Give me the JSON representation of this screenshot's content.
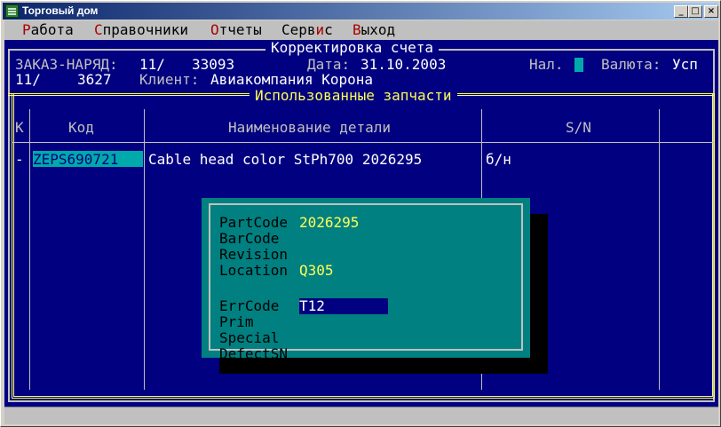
{
  "window": {
    "title": "Торговый дом",
    "min_glyph": "_",
    "max_glyph": "□",
    "close_glyph": "×"
  },
  "menu": {
    "items": [
      {
        "hotkey": "Р",
        "rest": "абота"
      },
      {
        "hotkey": "С",
        "rest": "правочники"
      },
      {
        "hotkey": "О",
        "rest": "тчеты"
      },
      {
        "hotkey": "",
        "rest": "Серв",
        "hotkey2": "и",
        "rest2": "с"
      },
      {
        "hotkey": "В",
        "rest": "ыход"
      }
    ]
  },
  "header": {
    "title": "Корректировка счета",
    "order_label": "ЗАКАЗ-НАРЯД:",
    "order_prefix": "11/",
    "order_number": "33093",
    "date_label": "Дата:",
    "date_value": "31.10.2003",
    "nal_label": "Нал.",
    "currency_label": "Валюта:",
    "currency_value": "Усп",
    "line2_prefix": "11/",
    "line2_number": "3627",
    "client_label": "Клиент:",
    "client_value": "Авиакомпания Корона"
  },
  "parts_panel": {
    "title": "Использованные запчасти",
    "columns": {
      "k": "К",
      "code": "Код",
      "name": "Наименование детали",
      "sn": "S/N"
    },
    "rows": [
      {
        "k": "-",
        "code": "ZEPS690721",
        "name": "Cable head color StPh700 2026295",
        "sn": "б/н"
      }
    ]
  },
  "dialog": {
    "fields": [
      {
        "label": "PartCode",
        "value": "2026295"
      },
      {
        "label": "BarCode",
        "value": ""
      },
      {
        "label": "Revision",
        "value": ""
      },
      {
        "label": "Location",
        "value": "Q305"
      },
      {
        "label": "ErrCode",
        "value": "T12"
      },
      {
        "label": "Prim",
        "value": ""
      },
      {
        "label": "Special",
        "value": ""
      },
      {
        "label": "DefectSN",
        "value": ""
      }
    ]
  },
  "colors": {
    "console_bg": "#000080",
    "dialog_bg": "#008080",
    "highlight": "#00aaaa",
    "value_yellow": "#ffff55",
    "title_bar": "#0a246a"
  }
}
